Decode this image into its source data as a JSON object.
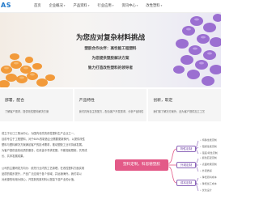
{
  "nav": {
    "logo": "AS",
    "items": [
      "首页",
      "企业概况",
      "产品资料",
      "行业应用",
      "资讯中心",
      "改性塑料"
    ]
  },
  "hero": {
    "title": "为您应对复杂材料挑战",
    "lines": [
      "塑胶合作伙伴：高性能工程塑料",
      "为您提供塑胶解决方案",
      "致力打造改性塑料的领导者"
    ],
    "colors": {
      "left_pellets": "#f29a3a",
      "right_pellets": "#9b6fd1"
    }
  },
  "columns": [
    {
      "title": "部署，配合",
      "desc": "了解客户需求，提供改性塑料解决方案"
    },
    {
      "title": "产品特性",
      "desc": "我们具有自主的配方，配合客户开发需求，分析产品特性"
    },
    {
      "title": "创新，取定",
      "desc": "我们除了解决方案外，还为客户提供加工工艺"
    }
  ],
  "lower": {
    "paragraphs": [
      [
        "成立于长江三角洲中心，为国内领先的改性塑料生产企业之一，",
        "目前专注于工程塑料，对于60%的制造企业需要更新换代，以提供改性",
        "塑料与塑料解决方案满足客户的技术需求，推动塑胶工业可持续发展。",
        "为客户提供高效优质的服务，在改善中寻求发展，不断突破限制，共同成",
        "长、共享发展成果。"
      ],
      [
        "公司的主要研发方向为：依托行业内的工艺原理，在改性塑料方面实现",
        "品质的稳步提升，产品广泛应用于各个领域，并远销海外。我们将以",
        "对资源的利用为核心，开发新的原材料以提高下游产业的价值。"
      ]
    ]
  },
  "mindmap": {
    "center": "塑料定制，科思德塑胶",
    "nodes": [
      "物性定制",
      "外观定制",
      "成本定制"
    ],
    "leaves": [
      [
        "• 特殊性能定制",
        "• 阻燃性能定制",
        "• 强度/韧性定制"
      ],
      [
        "• 颜色匹配定制",
        "• 表面效果定制",
        "• 外观质感"
      ],
      [
        "• 降低原料成本",
        "• 降低加工成本",
        "• 优化设计"
      ]
    ],
    "colors": {
      "center": "#e35a88",
      "node_border": "#8a63b8",
      "line": "#e35a88"
    }
  }
}
